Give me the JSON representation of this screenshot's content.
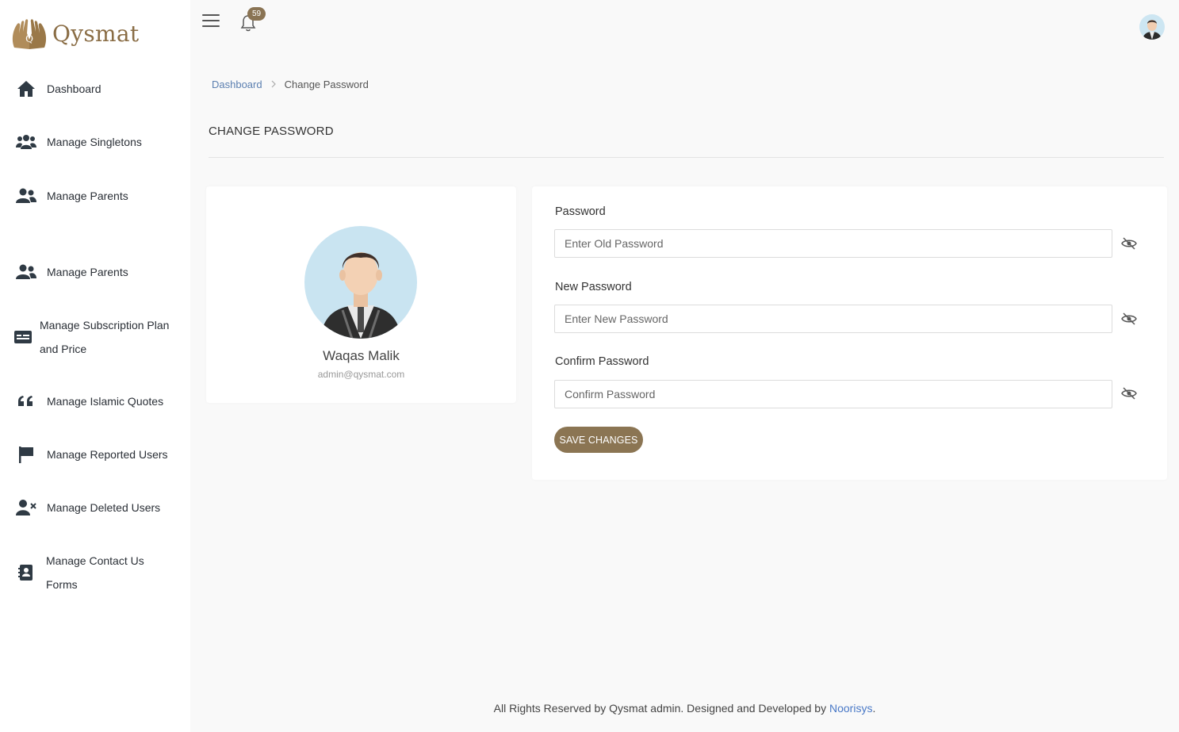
{
  "app": {
    "logo_text": "Qysmat",
    "notification_count": "59"
  },
  "sidebar": {
    "items": [
      {
        "label": "Dashboard",
        "icon": "home-icon"
      },
      {
        "label": "Manage Singletons",
        "icon": "users-icon"
      },
      {
        "label": "Manage Parents",
        "icon": "user-friends-icon"
      },
      {
        "label": "Manage Parents",
        "icon": "user-friends-icon"
      },
      {
        "label_line1": "Manage Subscription Plan",
        "label_line2": "and Price",
        "icon": "id-card-icon"
      },
      {
        "label": "Manage Islamic Quotes",
        "icon": "quote-icon"
      },
      {
        "label": "Manage Reported Users",
        "icon": "flag-icon"
      },
      {
        "label": "Manage Deleted Users",
        "icon": "user-times-icon"
      },
      {
        "label_line1": "Manage Contact Us",
        "label_line2": "Forms",
        "icon": "contact-book-icon"
      }
    ]
  },
  "breadcrumb": {
    "home": "Dashboard",
    "separator": ">",
    "current": "Change Password"
  },
  "page": {
    "title": "CHANGE PASSWORD"
  },
  "profile": {
    "name": "Waqas Malik",
    "email": "admin@qysmat.com"
  },
  "form": {
    "password_label": "Password",
    "password_placeholder": "Enter Old Password",
    "new_password_label": "New Password",
    "new_password_placeholder": "Enter New Password",
    "confirm_password_label": "Confirm Password",
    "confirm_password_placeholder": "Confirm Password",
    "save_label": "SAVE CHANGES"
  },
  "footer": {
    "text": "All Rights Reserved by Qysmat admin. Designed and Developed by",
    "link": "Noorisys",
    "end": "."
  },
  "colors": {
    "brand": "#8b7553",
    "link": "#4a79c7",
    "sidebar_bg": "#ffffff",
    "page_bg": "#f9f9f9"
  }
}
